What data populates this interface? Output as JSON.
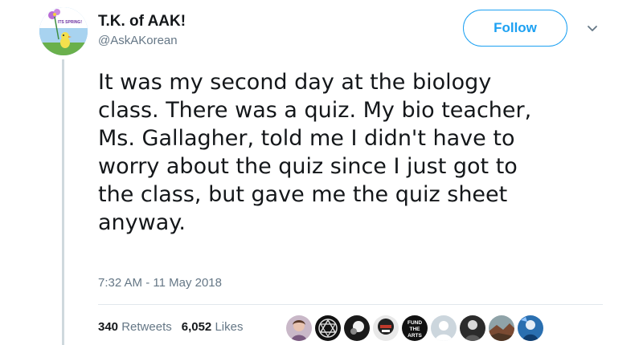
{
  "tweet": {
    "author": {
      "display_name": "T.K. of AAK!",
      "handle": "@AskAKorean",
      "avatar_icon": "spring-flower-avatar",
      "avatar_text": "ITS SPRING!"
    },
    "follow_label": "Follow",
    "more_icon": "chevron-down-icon",
    "text_lines": [
      "It was my second day at the biology",
      "class. There was a quiz. My bio teacher,",
      "Ms. Gallagher, told me I didn't have to",
      "worry about the quiz since I just got to",
      "the class, but gave me the quiz sheet",
      "anyway."
    ],
    "timestamp": "7:32 AM - 11 May 2018",
    "retweets": {
      "count": "340",
      "label": "Retweets"
    },
    "likes": {
      "count": "6,052",
      "label": "Likes"
    },
    "likers": [
      {
        "name": "liker-avatar-1",
        "icon": "person-photo"
      },
      {
        "name": "liker-avatar-2",
        "icon": "geometric-logo"
      },
      {
        "name": "liker-avatar-3",
        "icon": "dark-photo"
      },
      {
        "name": "liker-avatar-4",
        "icon": "masked-figure"
      },
      {
        "name": "liker-avatar-5",
        "icon": "fund-the-arts-badge",
        "text": "FUND THE ARTS"
      },
      {
        "name": "liker-avatar-6",
        "icon": "default-egg-avatar"
      },
      {
        "name": "liker-avatar-7",
        "icon": "black-white-photo"
      },
      {
        "name": "liker-avatar-8",
        "icon": "landscape-photo"
      },
      {
        "name": "liker-avatar-9",
        "icon": "blue-figure-photo"
      }
    ]
  },
  "colors": {
    "accent": "#1da1f2",
    "text_primary": "#14171a",
    "text_secondary": "#657786",
    "divider": "#e1e8ed"
  }
}
